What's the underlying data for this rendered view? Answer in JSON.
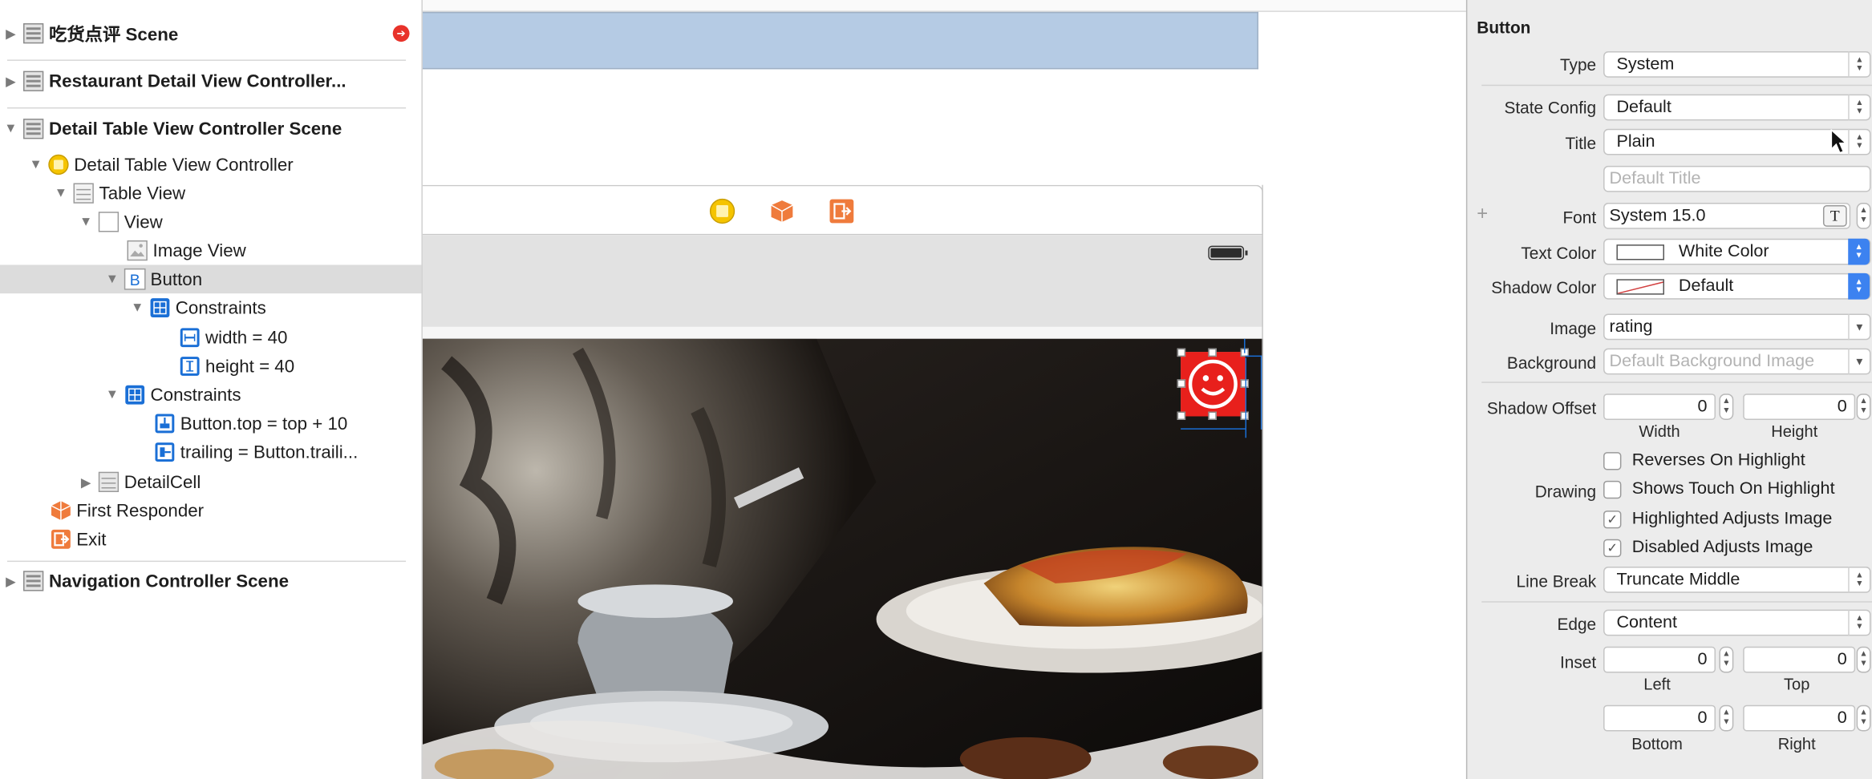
{
  "outline": {
    "scenes": [
      {
        "label": "吃货点评 Scene",
        "has_error_badge": true
      },
      {
        "label": "Restaurant Detail View Controller..."
      },
      {
        "label": "Detail Table View Controller Scene"
      },
      {
        "label": "Navigation Controller Scene"
      }
    ],
    "tree": {
      "detail_vc": "Detail Table View Controller",
      "table_view": "Table View",
      "view": "View",
      "image_view": "Image View",
      "button": "Button",
      "button_constraints": "Constraints",
      "width_constraint": "width = 40",
      "height_constraint": "height = 40",
      "view_constraints": "Constraints",
      "top_constraint": "Button.top = top + 10",
      "trailing_constraint": "trailing = Button.traili...",
      "detail_cell": "DetailCell",
      "first_responder": "First Responder",
      "exit": "Exit"
    },
    "icon_letters": {
      "button": "B"
    }
  },
  "inspector": {
    "section_title": "Button",
    "type": {
      "label": "Type",
      "value": "System"
    },
    "state_config": {
      "label": "State Config",
      "value": "Default"
    },
    "title": {
      "label": "Title",
      "value": "Plain",
      "placeholder": "Default Title"
    },
    "font": {
      "label": "Font",
      "value": "System 15.0",
      "add_symbol": "+"
    },
    "text_color": {
      "label": "Text Color",
      "value": "White Color"
    },
    "shadow_color": {
      "label": "Shadow Color",
      "value": "Default"
    },
    "image": {
      "label": "Image",
      "value": "rating"
    },
    "background": {
      "label": "Background",
      "placeholder": "Default Background Image"
    },
    "shadow_offset": {
      "label": "Shadow Offset",
      "width": "0",
      "height": "0",
      "width_label": "Width",
      "height_label": "Height"
    },
    "drawing": {
      "label": "Drawing",
      "options": [
        {
          "label": "Reverses On Highlight",
          "checked": false
        },
        {
          "label": "Shows Touch On Highlight",
          "checked": false
        },
        {
          "label": "Highlighted Adjusts Image",
          "checked": true
        },
        {
          "label": "Disabled Adjusts Image",
          "checked": true
        }
      ]
    },
    "line_break": {
      "label": "Line Break",
      "value": "Truncate Middle"
    },
    "edge": {
      "label": "Edge",
      "value": "Content"
    },
    "inset": {
      "label": "Inset",
      "left": "0",
      "top": "0",
      "bottom": "0",
      "right": "0",
      "left_label": "Left",
      "top_label": "Top",
      "bottom_label": "Bottom",
      "right_label": "Right"
    }
  },
  "colors": {
    "selection": "#dcdcdc",
    "canvas_blue": "#b5cbe4",
    "rating_red": "#e8201c",
    "accent_blue": "#3c82f0",
    "constraint_blue": "#1a6fd6",
    "orange": "#ef7b3c",
    "yellow": "#f5c400"
  }
}
